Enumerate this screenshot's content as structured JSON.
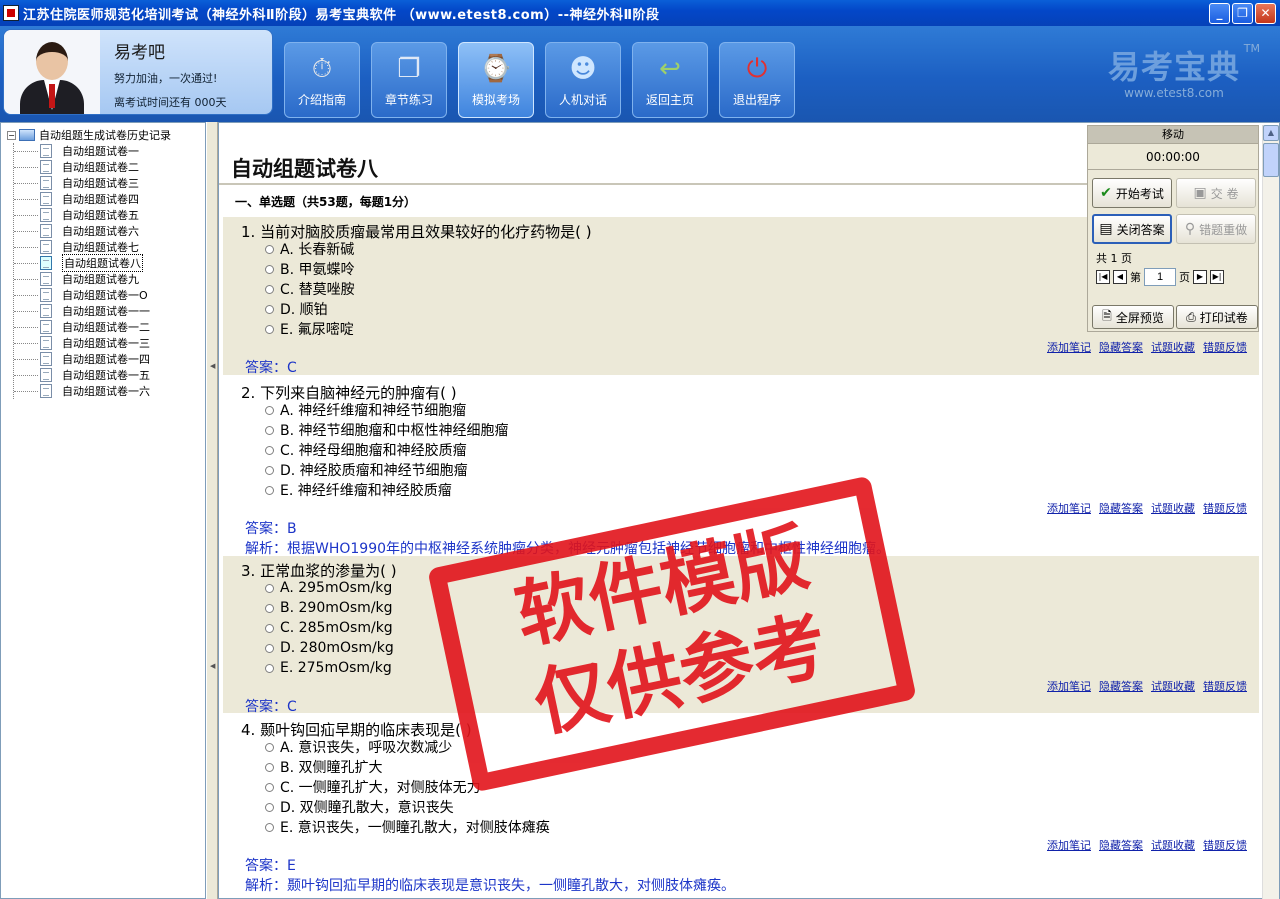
{
  "window": {
    "title": "江苏住院医师规范化培训考试（神经外科Ⅱ阶段）易考宝典软件  （www.etest8.com）--神经外科Ⅱ阶段",
    "minimize": "_",
    "maximize": "❐",
    "close": "✕"
  },
  "user": {
    "name": "易考吧",
    "motto": "努力加油，一次通过!",
    "days_left": "离考试时间还有 000天"
  },
  "toolbar": [
    {
      "label": "介绍指南",
      "icon": "stopwatch-icon",
      "glyph": "⏱"
    },
    {
      "label": "章节练习",
      "icon": "windows-icon",
      "glyph": "❐"
    },
    {
      "label": "模拟考场",
      "icon": "clock-icon",
      "glyph": "⌚"
    },
    {
      "label": "人机对话",
      "icon": "computer-user-icon",
      "glyph": "☻"
    },
    {
      "label": "返回主页",
      "icon": "return-arrow-icon",
      "glyph": "↩"
    },
    {
      "label": "退出程序",
      "icon": "power-icon",
      "glyph": "⏻"
    }
  ],
  "logo": {
    "text": "易考宝典",
    "url": "www.etest8.com",
    "tm": "TM"
  },
  "tree": {
    "root": "自动组题生成试卷历史记录",
    "items": [
      "自动组题试卷一",
      "自动组题试卷二",
      "自动组题试卷三",
      "自动组题试卷四",
      "自动组题试卷五",
      "自动组题试卷六",
      "自动组题试卷七",
      "自动组题试卷八",
      "自动组题试卷九",
      "自动组题试卷一O",
      "自动组题试卷一一",
      "自动组题试卷一二",
      "自动组题试卷一三",
      "自动组题试卷一四",
      "自动组题试卷一五",
      "自动组题试卷一六"
    ],
    "selected_index": 7
  },
  "paper": {
    "title": "自动组题试卷八",
    "section": "一、单选题（共53题，每题1分）",
    "links": [
      "添加笔记",
      "隐藏答案",
      "试题收藏",
      "错题反馈"
    ],
    "questions": [
      {
        "title": "1. 当前对脑胶质瘤最常用且效果较好的化疗药物是( )",
        "options": [
          "A. 长春新碱",
          "B. 甲氨蝶呤",
          "C. 替莫唑胺",
          "D. 顺铂",
          "E. 氟尿嘧啶"
        ],
        "answer": "答案：C",
        "explanation": ""
      },
      {
        "title": "2. 下列来自脑神经元的肿瘤有( )",
        "options": [
          "A. 神经纤维瘤和神经节细胞瘤",
          "B. 神经节细胞瘤和中枢性神经细胞瘤",
          "C. 神经母细胞瘤和神经胶质瘤",
          "D. 神经胶质瘤和神经节细胞瘤",
          "E. 神经纤维瘤和神经胶质瘤"
        ],
        "answer": "答案：B",
        "explanation": "解析：根据WHO1990年的中枢神经系统肿瘤分类，神经元肿瘤包括神经节细胞瘤和中枢性神经细胞瘤。"
      },
      {
        "title": "3. 正常血浆的渗量为( )",
        "options": [
          "A. 295mOsm/kg",
          "B. 290mOsm/kg",
          "C. 285mOsm/kg",
          "D. 280mOsm/kg",
          "E. 275mOsm/kg"
        ],
        "answer": "答案：C",
        "explanation": ""
      },
      {
        "title": "4. 颞叶钩回疝早期的临床表现是( )",
        "options": [
          "A. 意识丧失，呼吸次数减少",
          "B. 双侧瞳孔扩大",
          "C. 一侧瞳孔扩大，对侧肢体无力",
          "D. 双侧瞳孔散大，意识丧失",
          "E. 意识丧失，一侧瞳孔散大，对侧肢体瘫痪"
        ],
        "answer": "答案：E",
        "explanation": "解析：颞叶钩回疝早期的临床表现是意识丧失，一侧瞳孔散大，对侧肢体瘫痪。"
      }
    ]
  },
  "panel": {
    "move": "移动",
    "timer": "00:00:00",
    "start": "开始考试",
    "submit": "交    卷",
    "close_answer": "关闭答案",
    "redo_wrong": "错题重做",
    "pages": "共 1 页",
    "page_prefix": "第",
    "page_value": "1",
    "page_suffix": "页",
    "fullscreen": "全屏预览",
    "print": "打印试卷"
  },
  "stamp": {
    "line1": "软件模版",
    "line2": "仅供参考"
  },
  "colors": {
    "titlebar": "#0347c8",
    "header": "#1c5fc2",
    "answer": "#1d35c8",
    "stamp": "#e2141b"
  }
}
